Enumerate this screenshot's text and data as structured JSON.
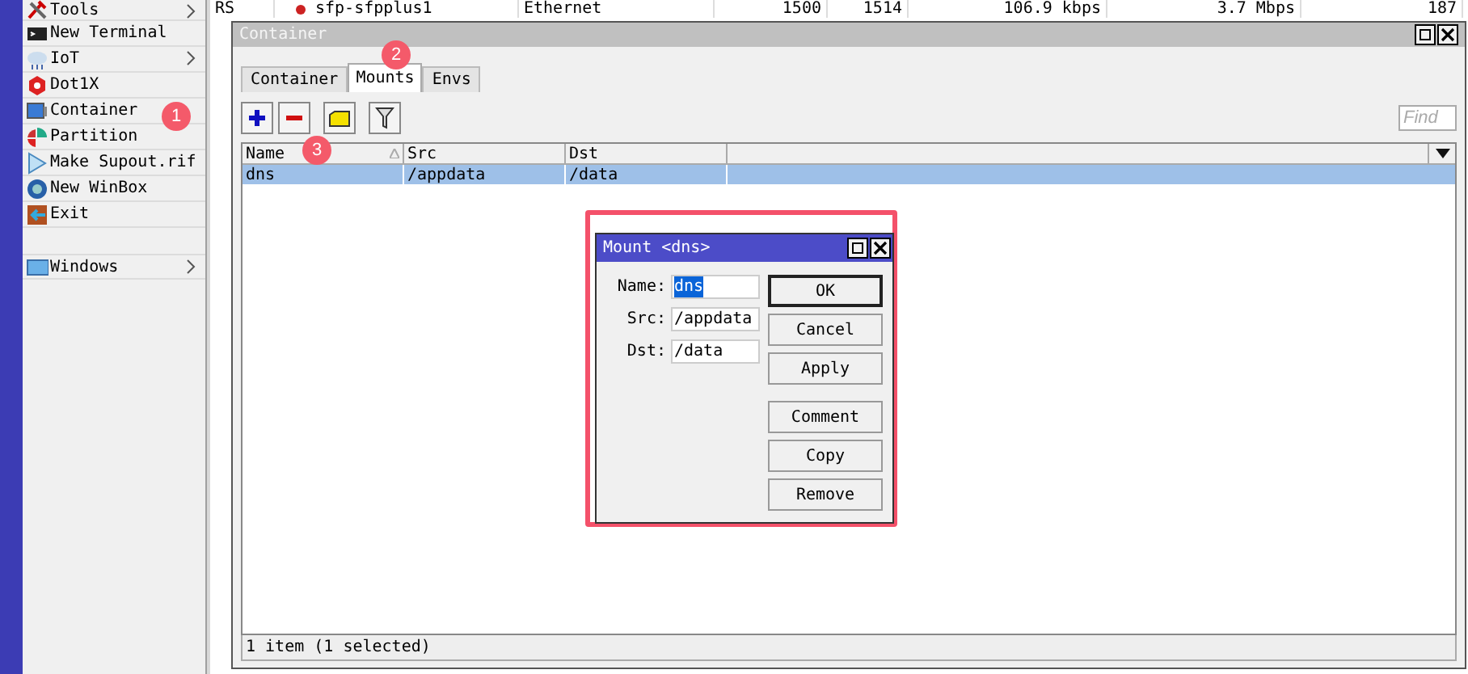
{
  "menu": {
    "items": [
      {
        "label": "Tools",
        "submenu": true
      },
      {
        "label": "New Terminal",
        "submenu": false
      },
      {
        "label": "IoT",
        "submenu": true
      },
      {
        "label": "Dot1X",
        "submenu": false
      },
      {
        "label": "Container",
        "submenu": false
      },
      {
        "label": "Partition",
        "submenu": false
      },
      {
        "label": "Make Supout.rif",
        "submenu": false
      },
      {
        "label": "New WinBox",
        "submenu": false
      },
      {
        "label": "Exit",
        "submenu": false
      },
      {
        "label": "Windows",
        "submenu": true
      }
    ]
  },
  "background_row": {
    "cells": [
      "RS",
      "sfp-sfpplus1",
      "Ethernet",
      "1500",
      "1514",
      "106.9 kbps",
      "3.7 Mbps",
      "187"
    ]
  },
  "container_window": {
    "title": "Container",
    "tabs": [
      {
        "label": "Container",
        "selected": false
      },
      {
        "label": "Mounts",
        "selected": true
      },
      {
        "label": "Envs",
        "selected": false
      }
    ],
    "find": {
      "placeholder": "Find"
    },
    "columns": [
      {
        "label": "Name",
        "sorted": true
      },
      {
        "label": "Src",
        "sorted": false
      },
      {
        "label": "Dst",
        "sorted": false
      }
    ],
    "rows": [
      {
        "cells": [
          "dns",
          "/appdata",
          "/data"
        ],
        "selected": true
      }
    ],
    "status_bar": "1 item (1 selected)"
  },
  "dialog": {
    "title": "Mount <dns>",
    "fields": [
      {
        "label": "Name:",
        "value": "dns",
        "selected": true
      },
      {
        "label": "Src:",
        "value": "/appdata",
        "selected": false
      },
      {
        "label": "Dst:",
        "value": "/data",
        "selected": false
      }
    ],
    "buttons": [
      {
        "label": "OK",
        "default": true
      },
      {
        "label": "Cancel",
        "default": false
      },
      {
        "label": "Apply",
        "default": false
      },
      {
        "label": "Comment",
        "default": false
      },
      {
        "label": "Copy",
        "default": false
      },
      {
        "label": "Remove",
        "default": false
      }
    ]
  },
  "annotations": [
    {
      "label": "1"
    },
    {
      "label": "2"
    },
    {
      "label": "3"
    }
  ]
}
